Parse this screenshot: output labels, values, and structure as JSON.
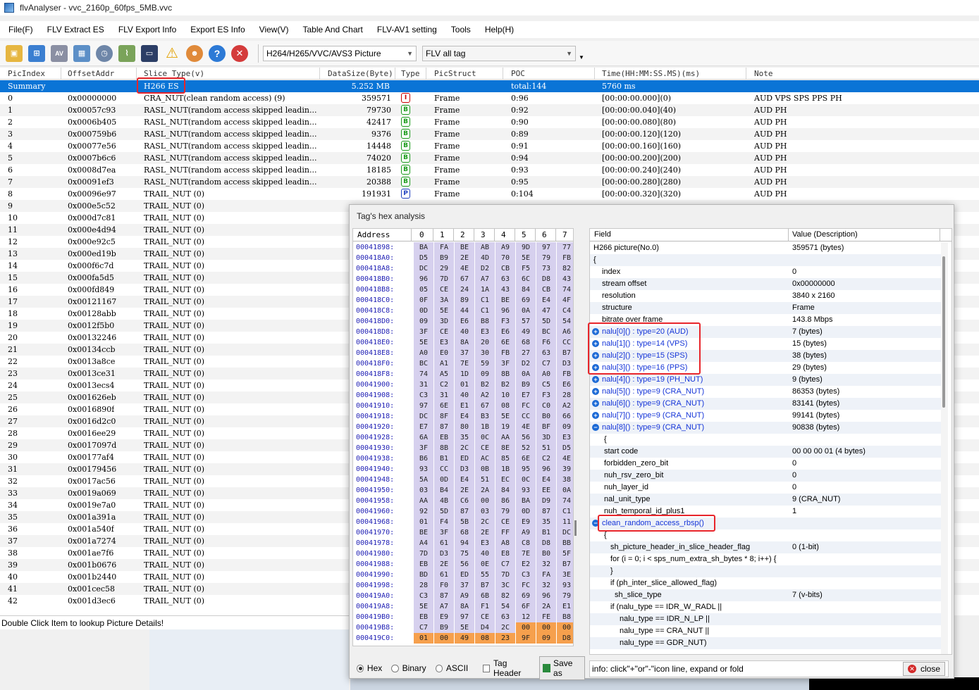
{
  "window": {
    "title": "flvAnalyser - vvc_2160p_60fps_5MB.vvc"
  },
  "menu": [
    "File(F)",
    "FLV Extract ES",
    "FLV Export Info",
    "Export ES Info",
    "View(V)",
    "Table And Chart",
    "FLV-AV1 setting",
    "Tools",
    "Help(H)"
  ],
  "toolbar": {
    "icons": [
      "open-folder-icon",
      "network-icon",
      "av-icon",
      "grid-icon",
      "clock-icon",
      "chart-icon",
      "monitor-icon",
      "warning-icon",
      "user-icon",
      "help-icon",
      "stop-icon"
    ],
    "codec_combo": "H264/H265/VVC/AVS3 Picture",
    "tag_combo": "FLV all tag"
  },
  "columns": [
    "PicIndex",
    "OffsetAddr",
    "Slice Type(v)",
    "DataSize(Byte)",
    "Type",
    "PicStruct",
    "POC",
    "Time(HH:MM:SS.MS)(ms)",
    "Note"
  ],
  "summary": {
    "index": "Summary",
    "slice": "H266 ES",
    "size": "5.252 MB",
    "poc": "total:144",
    "time": "5760 ms"
  },
  "rows": [
    {
      "i": "0",
      "off": "0x00000000",
      "slice": "CRA_NUT(clean random access) (9)",
      "size": "359571",
      "type": "I",
      "ps": "Frame",
      "poc": "0:96",
      "time": "[00:00:00.000](0)",
      "note": "AUD VPS SPS PPS PH"
    },
    {
      "i": "1",
      "off": "0x00057c93",
      "slice": "RASL_NUT(random access skipped leadin...",
      "size": "79730",
      "type": "B",
      "ps": "Frame",
      "poc": "0:92",
      "time": "[00:00:00.040](40)",
      "note": "AUD PH"
    },
    {
      "i": "2",
      "off": "0x0006b405",
      "slice": "RASL_NUT(random access skipped leadin...",
      "size": "42417",
      "type": "B",
      "ps": "Frame",
      "poc": "0:90",
      "time": "[00:00:00.080](80)",
      "note": "AUD PH"
    },
    {
      "i": "3",
      "off": "0x000759b6",
      "slice": "RASL_NUT(random access skipped leadin...",
      "size": "9376",
      "type": "B",
      "ps": "Frame",
      "poc": "0:89",
      "time": "[00:00:00.120](120)",
      "note": "AUD PH"
    },
    {
      "i": "4",
      "off": "0x00077e56",
      "slice": "RASL_NUT(random access skipped leadin...",
      "size": "14448",
      "type": "B",
      "ps": "Frame",
      "poc": "0:91",
      "time": "[00:00:00.160](160)",
      "note": "AUD PH"
    },
    {
      "i": "5",
      "off": "0x0007b6c6",
      "slice": "RASL_NUT(random access skipped leadin...",
      "size": "74020",
      "type": "B",
      "ps": "Frame",
      "poc": "0:94",
      "time": "[00:00:00.200](200)",
      "note": "AUD PH"
    },
    {
      "i": "6",
      "off": "0x0008d7ea",
      "slice": "RASL_NUT(random access skipped leadin...",
      "size": "18185",
      "type": "B",
      "ps": "Frame",
      "poc": "0:93",
      "time": "[00:00:00.240](240)",
      "note": "AUD PH"
    },
    {
      "i": "7",
      "off": "0x00091ef3",
      "slice": "RASL_NUT(random access skipped leadin...",
      "size": "20388",
      "type": "B",
      "ps": "Frame",
      "poc": "0:95",
      "time": "[00:00:00.280](280)",
      "note": "AUD PH"
    },
    {
      "i": "8",
      "off": "0x00096e97",
      "slice": "TRAIL_NUT (0)",
      "size": "191931",
      "type": "P",
      "ps": "Frame",
      "poc": "0:104",
      "time": "[00:00:00.320](320)",
      "note": "AUD PH"
    },
    {
      "i": "9",
      "off": "0x000e5c52",
      "slice": "TRAIL_NUT (0)"
    },
    {
      "i": "10",
      "off": "0x000d7c81",
      "slice": "TRAIL_NUT (0)"
    },
    {
      "i": "11",
      "off": "0x000e4d94",
      "slice": "TRAIL_NUT (0)"
    },
    {
      "i": "12",
      "off": "0x000e92c5",
      "slice": "TRAIL_NUT (0)"
    },
    {
      "i": "13",
      "off": "0x000ed19b",
      "slice": "TRAIL_NUT (0)"
    },
    {
      "i": "14",
      "off": "0x000f6c7d",
      "slice": "TRAIL_NUT (0)"
    },
    {
      "i": "15",
      "off": "0x000fa5d5",
      "slice": "TRAIL_NUT (0)"
    },
    {
      "i": "16",
      "off": "0x000fd849",
      "slice": "TRAIL_NUT (0)"
    },
    {
      "i": "17",
      "off": "0x00121167",
      "slice": "TRAIL_NUT (0)"
    },
    {
      "i": "18",
      "off": "0x00128abb",
      "slice": "TRAIL_NUT (0)"
    },
    {
      "i": "19",
      "off": "0x0012f5b0",
      "slice": "TRAIL_NUT (0)"
    },
    {
      "i": "20",
      "off": "0x00132246",
      "slice": "TRAIL_NUT (0)"
    },
    {
      "i": "21",
      "off": "0x00134ccb",
      "slice": "TRAIL_NUT (0)"
    },
    {
      "i": "22",
      "off": "0x0013a8ce",
      "slice": "TRAIL_NUT (0)"
    },
    {
      "i": "23",
      "off": "0x0013ce31",
      "slice": "TRAIL_NUT (0)"
    },
    {
      "i": "24",
      "off": "0x0013ecs4",
      "slice": "TRAIL_NUT (0)"
    },
    {
      "i": "25",
      "off": "0x001626eb",
      "slice": "TRAIL_NUT (0)"
    },
    {
      "i": "26",
      "off": "0x0016890f",
      "slice": "TRAIL_NUT (0)"
    },
    {
      "i": "27",
      "off": "0x0016d2c0",
      "slice": "TRAIL_NUT (0)"
    },
    {
      "i": "28",
      "off": "0x0016ee29",
      "slice": "TRAIL_NUT (0)"
    },
    {
      "i": "29",
      "off": "0x0017097d",
      "slice": "TRAIL_NUT (0)"
    },
    {
      "i": "30",
      "off": "0x00177af4",
      "slice": "TRAIL_NUT (0)"
    },
    {
      "i": "31",
      "off": "0x00179456",
      "slice": "TRAIL_NUT (0)"
    },
    {
      "i": "32",
      "off": "0x0017ac56",
      "slice": "TRAIL_NUT (0)"
    },
    {
      "i": "33",
      "off": "0x0019a069",
      "slice": "TRAIL_NUT (0)"
    },
    {
      "i": "34",
      "off": "0x0019e7a0",
      "slice": "TRAIL_NUT (0)"
    },
    {
      "i": "35",
      "off": "0x001a391a",
      "slice": "TRAIL_NUT (0)"
    },
    {
      "i": "36",
      "off": "0x001a540f",
      "slice": "TRAIL_NUT (0)"
    },
    {
      "i": "37",
      "off": "0x001a7274",
      "slice": "TRAIL_NUT (0)"
    },
    {
      "i": "38",
      "off": "0x001ae7f6",
      "slice": "TRAIL_NUT (0)"
    },
    {
      "i": "39",
      "off": "0x001b0676",
      "slice": "TRAIL_NUT (0)"
    },
    {
      "i": "40",
      "off": "0x001b2440",
      "slice": "TRAIL_NUT (0)"
    },
    {
      "i": "41",
      "off": "0x001cec58",
      "slice": "TRAIL_NUT (0)"
    },
    {
      "i": "42",
      "off": "0x001d3ec6",
      "slice": "TRAIL_NUT (0)"
    }
  ],
  "status": "Double Click Item to lookup Picture Details!",
  "dialog": {
    "title": "Tag's hex analysis",
    "hex_header": {
      "address": "Address",
      "cols": [
        "0",
        "1",
        "2",
        "3",
        "4",
        "5",
        "6",
        "7"
      ]
    },
    "hex_rows": [
      {
        "a": "00041898:",
        "b": [
          "BA",
          "FA",
          "BE",
          "AB",
          "A9",
          "9D",
          "97",
          "77"
        ]
      },
      {
        "a": "000418A0:",
        "b": [
          "D5",
          "B9",
          "2E",
          "4D",
          "70",
          "5E",
          "79",
          "FB"
        ]
      },
      {
        "a": "000418A8:",
        "b": [
          "DC",
          "29",
          "4E",
          "D2",
          "CB",
          "F5",
          "73",
          "82"
        ]
      },
      {
        "a": "000418B0:",
        "b": [
          "96",
          "7D",
          "67",
          "A7",
          "63",
          "6C",
          "D8",
          "43"
        ]
      },
      {
        "a": "000418B8:",
        "b": [
          "05",
          "CE",
          "24",
          "1A",
          "43",
          "84",
          "CB",
          "74"
        ]
      },
      {
        "a": "000418C0:",
        "b": [
          "0F",
          "3A",
          "89",
          "C1",
          "BE",
          "69",
          "E4",
          "4F"
        ]
      },
      {
        "a": "000418C8:",
        "b": [
          "0D",
          "5E",
          "44",
          "C1",
          "96",
          "0A",
          "47",
          "C4"
        ]
      },
      {
        "a": "000418D0:",
        "b": [
          "09",
          "3D",
          "E6",
          "B8",
          "F3",
          "57",
          "5D",
          "54"
        ]
      },
      {
        "a": "000418D8:",
        "b": [
          "3F",
          "CE",
          "40",
          "E3",
          "E6",
          "49",
          "BC",
          "A6"
        ]
      },
      {
        "a": "000418E0:",
        "b": [
          "5E",
          "E3",
          "8A",
          "20",
          "6E",
          "68",
          "F6",
          "CC"
        ]
      },
      {
        "a": "000418E8:",
        "b": [
          "A0",
          "E0",
          "37",
          "30",
          "FB",
          "27",
          "63",
          "B7"
        ]
      },
      {
        "a": "000418F0:",
        "b": [
          "BC",
          "A1",
          "7E",
          "59",
          "3F",
          "D2",
          "C7",
          "D3"
        ]
      },
      {
        "a": "000418F8:",
        "b": [
          "74",
          "A5",
          "1D",
          "09",
          "8B",
          "0A",
          "A0",
          "FB"
        ]
      },
      {
        "a": "00041900:",
        "b": [
          "31",
          "C2",
          "01",
          "B2",
          "B2",
          "B9",
          "C5",
          "E6"
        ]
      },
      {
        "a": "00041908:",
        "b": [
          "C3",
          "31",
          "40",
          "A2",
          "10",
          "E7",
          "F3",
          "28"
        ]
      },
      {
        "a": "00041910:",
        "b": [
          "97",
          "6E",
          "E1",
          "67",
          "08",
          "FC",
          "C0",
          "A2"
        ]
      },
      {
        "a": "00041918:",
        "b": [
          "DC",
          "8F",
          "E4",
          "B3",
          "5E",
          "CC",
          "B0",
          "66"
        ]
      },
      {
        "a": "00041920:",
        "b": [
          "E7",
          "87",
          "80",
          "1B",
          "19",
          "4E",
          "BF",
          "09"
        ]
      },
      {
        "a": "00041928:",
        "b": [
          "6A",
          "EB",
          "35",
          "0C",
          "AA",
          "56",
          "3D",
          "E3"
        ]
      },
      {
        "a": "00041930:",
        "b": [
          "3F",
          "8B",
          "2C",
          "CE",
          "8E",
          "52",
          "51",
          "D5"
        ]
      },
      {
        "a": "00041938:",
        "b": [
          "B6",
          "B1",
          "ED",
          "AC",
          "85",
          "6E",
          "C2",
          "4E"
        ]
      },
      {
        "a": "00041940:",
        "b": [
          "93",
          "CC",
          "D3",
          "0B",
          "1B",
          "95",
          "96",
          "39"
        ]
      },
      {
        "a": "00041948:",
        "b": [
          "5A",
          "0D",
          "E4",
          "51",
          "EC",
          "0C",
          "E4",
          "38"
        ]
      },
      {
        "a": "00041950:",
        "b": [
          "03",
          "B4",
          "2E",
          "2A",
          "84",
          "93",
          "EE",
          "0A"
        ]
      },
      {
        "a": "00041958:",
        "b": [
          "AA",
          "4B",
          "C6",
          "00",
          "86",
          "BA",
          "D9",
          "74"
        ]
      },
      {
        "a": "00041960:",
        "b": [
          "92",
          "5D",
          "87",
          "03",
          "79",
          "0D",
          "87",
          "C1"
        ]
      },
      {
        "a": "00041968:",
        "b": [
          "01",
          "F4",
          "5B",
          "2C",
          "CE",
          "E9",
          "35",
          "11"
        ]
      },
      {
        "a": "00041970:",
        "b": [
          "BE",
          "3F",
          "68",
          "2E",
          "FF",
          "A9",
          "B1",
          "DC"
        ]
      },
      {
        "a": "00041978:",
        "b": [
          "A4",
          "61",
          "94",
          "E3",
          "A8",
          "C8",
          "D8",
          "BB"
        ]
      },
      {
        "a": "00041980:",
        "b": [
          "7D",
          "D3",
          "75",
          "40",
          "E8",
          "7E",
          "B0",
          "5F"
        ]
      },
      {
        "a": "00041988:",
        "b": [
          "EB",
          "2E",
          "56",
          "0E",
          "C7",
          "E2",
          "32",
          "B7"
        ]
      },
      {
        "a": "00041990:",
        "b": [
          "BD",
          "61",
          "ED",
          "55",
          "7D",
          "C3",
          "FA",
          "3E"
        ]
      },
      {
        "a": "00041998:",
        "b": [
          "28",
          "F0",
          "37",
          "B7",
          "3C",
          "FC",
          "32",
          "93"
        ]
      },
      {
        "a": "000419A0:",
        "b": [
          "C3",
          "87",
          "A9",
          "6B",
          "82",
          "69",
          "96",
          "79"
        ]
      },
      {
        "a": "000419A8:",
        "b": [
          "5E",
          "A7",
          "8A",
          "F1",
          "54",
          "6F",
          "2A",
          "E1"
        ]
      },
      {
        "a": "000419B0:",
        "b": [
          "EB",
          "E9",
          "97",
          "CE",
          "63",
          "12",
          "FE",
          "B8"
        ]
      },
      {
        "a": "000419B8:",
        "b": [
          "C7",
          "B9",
          "5E",
          "D4",
          "2C",
          "00",
          "00",
          "00"
        ]
      },
      {
        "a": "000419C0:",
        "b": [
          "01",
          "00",
          "49",
          "08",
          "23",
          "9F",
          "09",
          "D8"
        ]
      }
    ],
    "field_header": {
      "field": "Field",
      "value": "Value (Description)"
    },
    "fields": [
      {
        "f": "H266 picture(No.0)",
        "v": "359571 (bytes)",
        "ind": 0
      },
      {
        "f": "{",
        "v": "",
        "ind": 0
      },
      {
        "f": "index",
        "v": "0",
        "ind": 1
      },
      {
        "f": "stream offset",
        "v": "0x00000000",
        "ind": 1
      },
      {
        "f": "resolution",
        "v": "3840 x 2160",
        "ind": 1
      },
      {
        "f": "structure",
        "v": "Frame",
        "ind": 1
      },
      {
        "f": "bitrate over frame",
        "v": "143.8 Mbps",
        "ind": 1
      },
      {
        "f": "nalu[0]() : type=20 (AUD)",
        "v": "7 (bytes)",
        "ind": 1,
        "link": true,
        "exp": "+"
      },
      {
        "f": "nalu[1]() : type=14 (VPS)",
        "v": "15 (bytes)",
        "ind": 1,
        "link": true,
        "exp": "+"
      },
      {
        "f": "nalu[2]() : type=15 (SPS)",
        "v": "38 (bytes)",
        "ind": 1,
        "link": true,
        "exp": "+"
      },
      {
        "f": "nalu[3]() : type=16 (PPS)",
        "v": "29 (bytes)",
        "ind": 1,
        "link": true,
        "exp": "+"
      },
      {
        "f": "nalu[4]() : type=19 (PH_NUT)",
        "v": "9 (bytes)",
        "ind": 1,
        "link": true,
        "exp": "+"
      },
      {
        "f": "nalu[5]() : type=9 (CRA_NUT)",
        "v": "86353 (bytes)",
        "ind": 1,
        "link": true,
        "exp": "+"
      },
      {
        "f": "nalu[6]() : type=9 (CRA_NUT)",
        "v": "83141 (bytes)",
        "ind": 1,
        "link": true,
        "exp": "+"
      },
      {
        "f": "nalu[7]() : type=9 (CRA_NUT)",
        "v": "99141 (bytes)",
        "ind": 1,
        "link": true,
        "exp": "+"
      },
      {
        "f": "nalu[8]() : type=9 (CRA_NUT)",
        "v": "90838 (bytes)",
        "ind": 1,
        "link": true,
        "exp": "-"
      },
      {
        "f": "{",
        "v": "",
        "ind": 2
      },
      {
        "f": "start code",
        "v": "00 00 00 01 (4 bytes)",
        "ind": 2
      },
      {
        "f": "forbidden_zero_bit",
        "v": "0",
        "ind": 2
      },
      {
        "f": "nuh_rsv_zero_bit",
        "v": "0",
        "ind": 2
      },
      {
        "f": "nuh_layer_id",
        "v": "0",
        "ind": 2
      },
      {
        "f": "nal_unit_type",
        "v": "9 (CRA_NUT)",
        "ind": 2
      },
      {
        "f": "nuh_temporal_id_plus1",
        "v": "1",
        "ind": 2
      },
      {
        "f": "clean_random_access_rbsp()",
        "v": "",
        "ind": 1,
        "link": true,
        "exp": "-"
      },
      {
        "f": "{",
        "v": "",
        "ind": 2
      },
      {
        "f": "sh_picture_header_in_slice_header_flag",
        "v": "0 (1-bit)",
        "ind": 3
      },
      {
        "f": "for (i = 0; i < sps_num_extra_sh_bytes * 8; i++) {",
        "v": "",
        "ind": 3
      },
      {
        "f": "}",
        "v": "",
        "ind": 3
      },
      {
        "f": "if (ph_inter_slice_allowed_flag)",
        "v": "",
        "ind": 3
      },
      {
        "f": "sh_slice_type",
        "v": "7 (v-bits)",
        "ind": 4
      },
      {
        "f": "if (nalu_type == IDR_W_RADL ||",
        "v": "",
        "ind": 3
      },
      {
        "f": "nalu_type == IDR_N_LP ||",
        "v": "",
        "ind": 5
      },
      {
        "f": "nalu_type == CRA_NUT ||",
        "v": "",
        "ind": 5
      },
      {
        "f": "nalu_type == GDR_NUT)",
        "v": "",
        "ind": 5
      }
    ],
    "bottom": {
      "hex": "Hex",
      "binary": "Binary",
      "ascii": "ASCII",
      "tag_header": "Tag Header",
      "save_as": "Save as",
      "info": "info: click\"+\"or\"-\"icon line, expand or fold",
      "close": "close"
    }
  }
}
